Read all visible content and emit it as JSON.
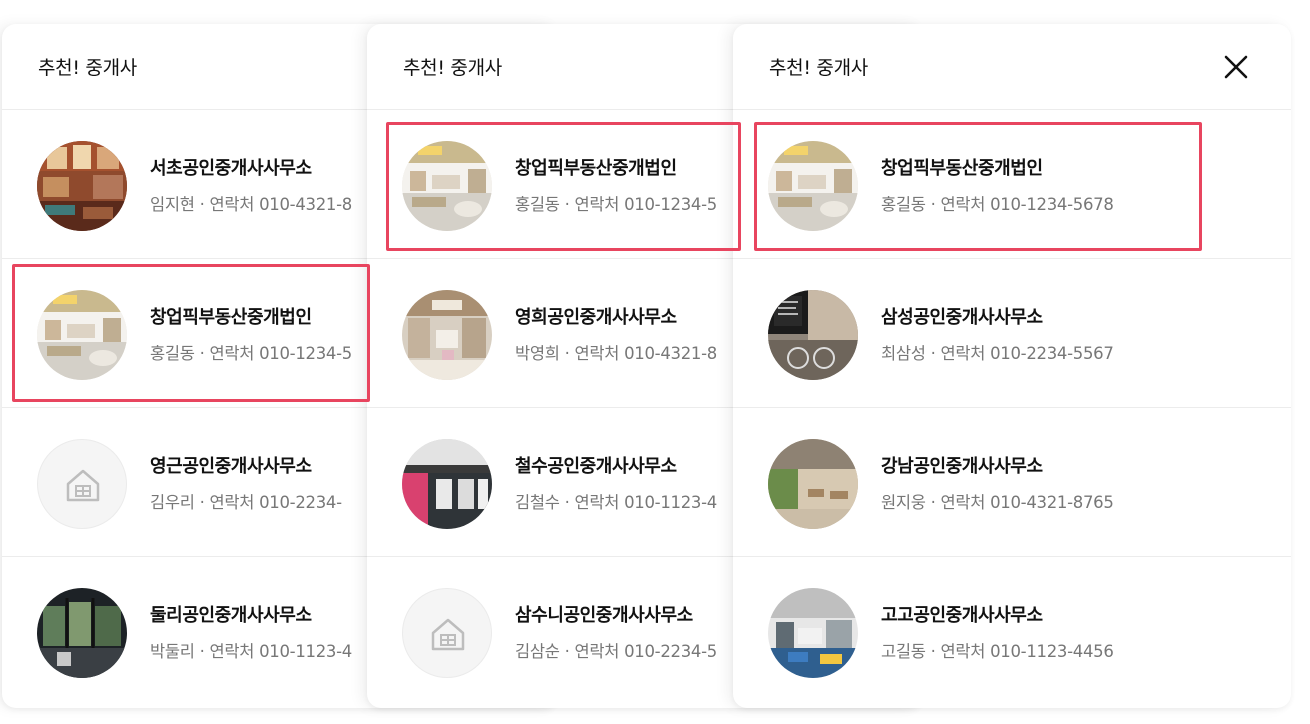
{
  "panels": [
    {
      "title": "추천! 중개사",
      "items": [
        {
          "name": "서초공인중개사사무소",
          "agent": "임지현",
          "label": "연락처",
          "phone": "010-4321-8",
          "image": "cafe-interior"
        },
        {
          "name": "창업픽부동산중개법인",
          "agent": "홍길동",
          "label": "연락처",
          "phone": "010-1234-5",
          "image": "shop-interior"
        },
        {
          "name": "영근공인중개사사무소",
          "agent": "김우리",
          "label": "연락처",
          "phone": "010-2234-",
          "image": "house-icon"
        },
        {
          "name": "둘리공인중개사사무소",
          "agent": "박둘리",
          "label": "연락처",
          "phone": "010-1123-4",
          "image": "office-glass"
        }
      ]
    },
    {
      "title": "추천! 중개사",
      "items": [
        {
          "name": "창업픽부동산중개법인",
          "agent": "홍길동",
          "label": "연락처",
          "phone": "010-1234-5",
          "image": "shop-interior"
        },
        {
          "name": "영희공인중개사사무소",
          "agent": "박영희",
          "label": "연락처",
          "phone": "010-4321-8",
          "image": "beauty-shop"
        },
        {
          "name": "철수공인중개사사무소",
          "agent": "김철수",
          "label": "연락처",
          "phone": "010-1123-4",
          "image": "storefront"
        },
        {
          "name": "삼수니공인중개사사무소",
          "agent": "김삼순",
          "label": "연락처",
          "phone": "010-2234-5",
          "image": "house-icon"
        }
      ]
    },
    {
      "title": "추천! 중개사",
      "close_icon": "close-icon",
      "items": [
        {
          "name": "창업픽부동산중개법인",
          "agent": "홍길동",
          "label": "연락처",
          "phone": "010-1234-5678",
          "image": "shop-interior"
        },
        {
          "name": "삼성공인중개사사무소",
          "agent": "최삼성",
          "label": "연락처",
          "phone": "010-2234-5567",
          "image": "bike-cafe"
        },
        {
          "name": "강남공인중개사사무소",
          "agent": "원지웅",
          "label": "연락처",
          "phone": "010-4321-8765",
          "image": "green-cafe"
        },
        {
          "name": "고고공인중개사사무소",
          "agent": "고길동",
          "label": "연락처",
          "phone": "010-1123-4456",
          "image": "blue-lounge"
        }
      ]
    }
  ],
  "separator": "·",
  "colors": {
    "highlight": "#e8455f",
    "name": "#111111",
    "contact": "#777777",
    "divider": "#ececec"
  }
}
